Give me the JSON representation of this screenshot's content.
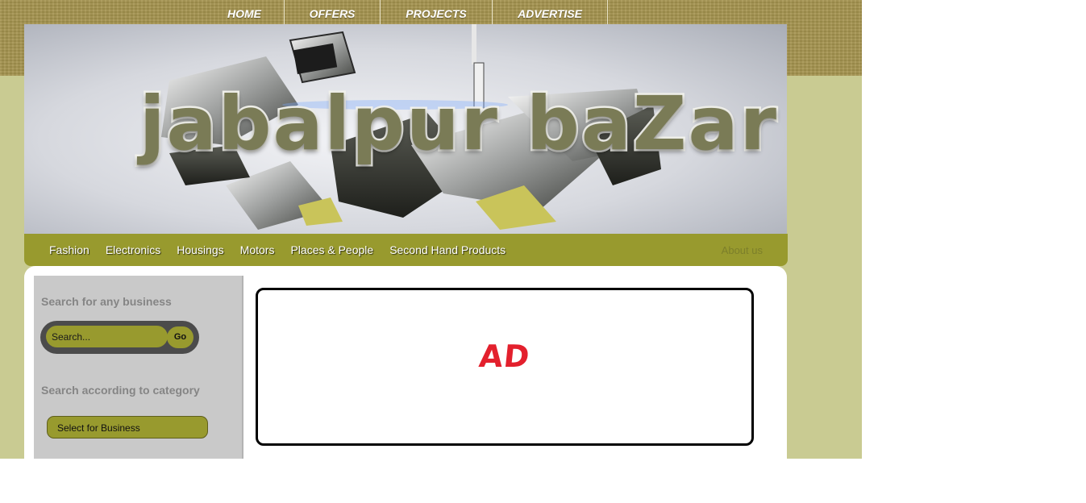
{
  "top_nav": [
    "HOME",
    "OFFERS",
    "PROJECTS",
    "ADVERTISE"
  ],
  "banner": {
    "logo_text": "jabalpur baZar"
  },
  "category_nav": {
    "items": [
      "Fashion",
      "Electronics",
      "Housings",
      "Motors",
      "Places & People",
      "Second Hand Products"
    ],
    "about": "About us"
  },
  "sidebar": {
    "search_heading": "Search for any business",
    "search_placeholder": "Search...",
    "go_label": "Go",
    "category_heading": "Search according to category",
    "select_value": "Select for Business"
  },
  "ad": {
    "text": "AD"
  },
  "colors": {
    "accent_olive": "#989a2e",
    "header_band": "#a5944f",
    "page_bg": "#c9cb92",
    "ad_red": "#e3202d"
  }
}
